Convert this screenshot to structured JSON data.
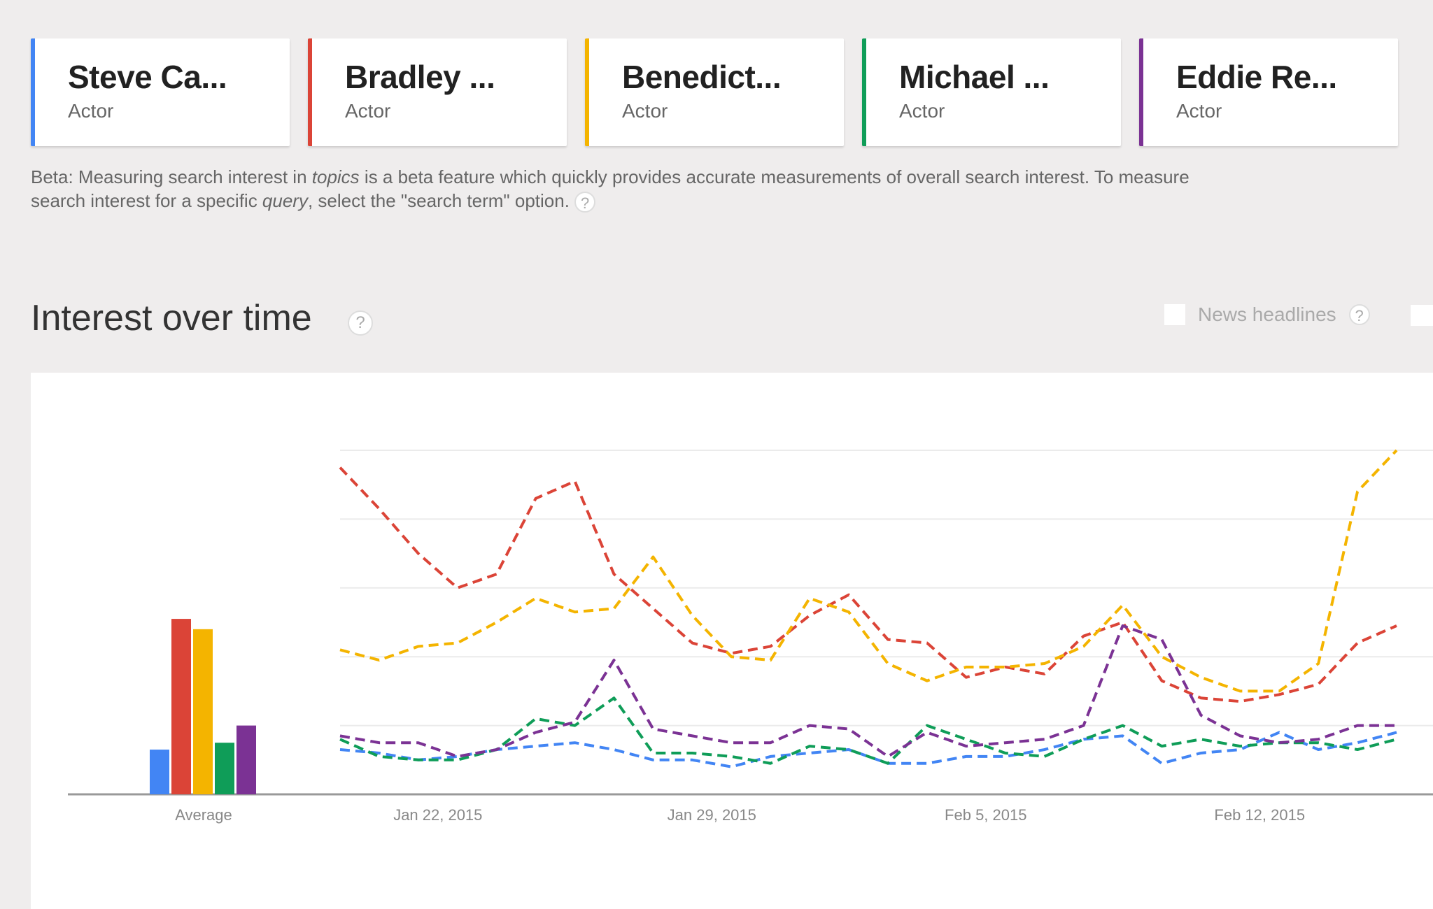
{
  "topics": [
    {
      "name": "Steve Ca...",
      "type": "Actor",
      "color": "#4285f4"
    },
    {
      "name": "Bradley ...",
      "type": "Actor",
      "color": "#db4437"
    },
    {
      "name": "Benedict...",
      "type": "Actor",
      "color": "#f4b400"
    },
    {
      "name": "Michael ...",
      "type": "Actor",
      "color": "#0f9d58"
    },
    {
      "name": "Eddie Re...",
      "type": "Actor",
      "color": "#7b3294"
    }
  ],
  "beta": {
    "part1": "Beta: Measuring search interest in ",
    "em1": "topics",
    "part2": " is a beta feature which quickly provides accurate measurements of overall search interest. To measure search interest for a specific ",
    "em2": "query",
    "part3": ", select the \"search term\" option.",
    "help": "?"
  },
  "section": {
    "title": "Interest over time",
    "help": "?",
    "news_label": "News headlines",
    "news_help": "?"
  },
  "chart_data": {
    "type": "line",
    "average_label": "Average",
    "averages": [
      13,
      51,
      48,
      15,
      20
    ],
    "x_start": "2015-01-19",
    "x_tick_labels": [
      "Jan 22, 2015",
      "Jan 29, 2015",
      "Feb 5, 2015",
      "Feb 12, 2015"
    ],
    "x_tick_dates": [
      "2015-01-22",
      "2015-01-29",
      "2015-02-05",
      "2015-02-12"
    ],
    "ylim": [
      0,
      100
    ],
    "grid": true,
    "line_style": "dashed",
    "series": [
      {
        "color": "#4285f4",
        "values": [
          13,
          12,
          10,
          11,
          13,
          14,
          15,
          13,
          10,
          10,
          8,
          11,
          12,
          13,
          9,
          9,
          11,
          11,
          13,
          16,
          17,
          9,
          12,
          13,
          18,
          13,
          15,
          18
        ]
      },
      {
        "color": "#db4437",
        "values": [
          95,
          83,
          70,
          60,
          64,
          86,
          91,
          64,
          54,
          44,
          41,
          43,
          52,
          58,
          45,
          44,
          34,
          37,
          35,
          46,
          50,
          33,
          28,
          27,
          29,
          32,
          44,
          49
        ]
      },
      {
        "color": "#f4b400",
        "values": [
          42,
          39,
          43,
          44,
          50,
          57,
          53,
          54,
          69,
          52,
          40,
          39,
          57,
          53,
          38,
          33,
          37,
          37,
          38,
          43,
          55,
          40,
          34,
          30,
          30,
          38,
          88,
          100
        ]
      },
      {
        "color": "#0f9d58",
        "values": [
          16,
          11,
          10,
          10,
          13,
          22,
          20,
          28,
          12,
          12,
          11,
          9,
          14,
          13,
          9,
          20,
          16,
          12,
          11,
          16,
          20,
          14,
          16,
          14,
          15,
          15,
          13,
          16
        ]
      },
      {
        "color": "#7b3294",
        "values": [
          17,
          15,
          15,
          11,
          13,
          18,
          21,
          39,
          19,
          17,
          15,
          15,
          20,
          19,
          11,
          18,
          14,
          15,
          16,
          20,
          49,
          45,
          23,
          17,
          15,
          16,
          20,
          20
        ]
      }
    ]
  }
}
